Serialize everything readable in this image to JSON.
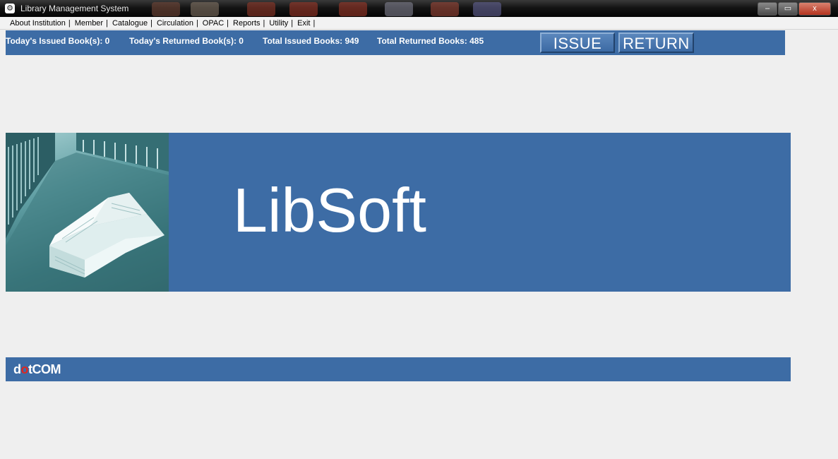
{
  "window": {
    "title": "Library Management System",
    "controls": {
      "minimize": "–",
      "maximize": "▭",
      "close": "x"
    }
  },
  "menu": {
    "items": [
      "About Institution",
      "Member",
      "Catalogue",
      "Circulation",
      "OPAC",
      "Reports",
      "Utility",
      "Exit"
    ],
    "separator": "|"
  },
  "stats": {
    "todays_issued": "Today's Issued Book(s): 0",
    "todays_returned": "Today's Returned Book(s): 0",
    "total_issued": "Total Issued Books: 949",
    "total_returned": "Total Returned Books: 485"
  },
  "actions": {
    "issue": "ISSUE",
    "return": "RETURN"
  },
  "banner": {
    "title": "LibSoft",
    "image": "library-aisle-open-book"
  },
  "footer": {
    "brand_prefix": "d",
    "brand_highlight": "o",
    "brand_suffix": "tCOM"
  },
  "colors": {
    "accent": "#3d6ca5",
    "background": "#efefef",
    "brand_highlight": "#e0261f"
  }
}
